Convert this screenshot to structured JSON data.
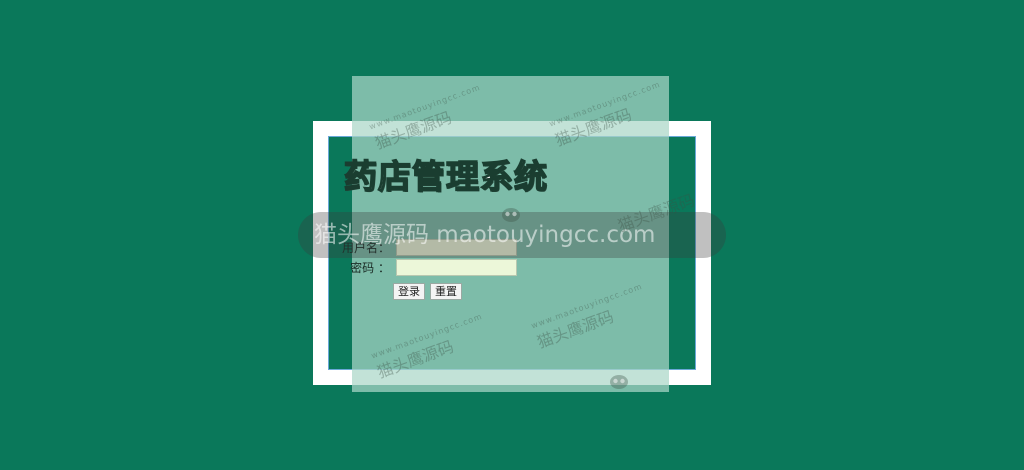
{
  "app": {
    "title": "药店管理系统"
  },
  "form": {
    "username_label": "用户名：",
    "password_label": "密码 ：",
    "username_value": "",
    "password_value": ""
  },
  "buttons": {
    "login": "登录",
    "reset": "重置"
  },
  "watermark": {
    "text": "猫头鹰源码 maotouyingcc.com",
    "site": "www.maotouyingcc.com",
    "brand": "猫头鹰源码"
  },
  "colors": {
    "background": "#0a785a",
    "frame": "#ffffff",
    "panel": "#aad7c8",
    "input_bg": "#ecf7d9"
  }
}
